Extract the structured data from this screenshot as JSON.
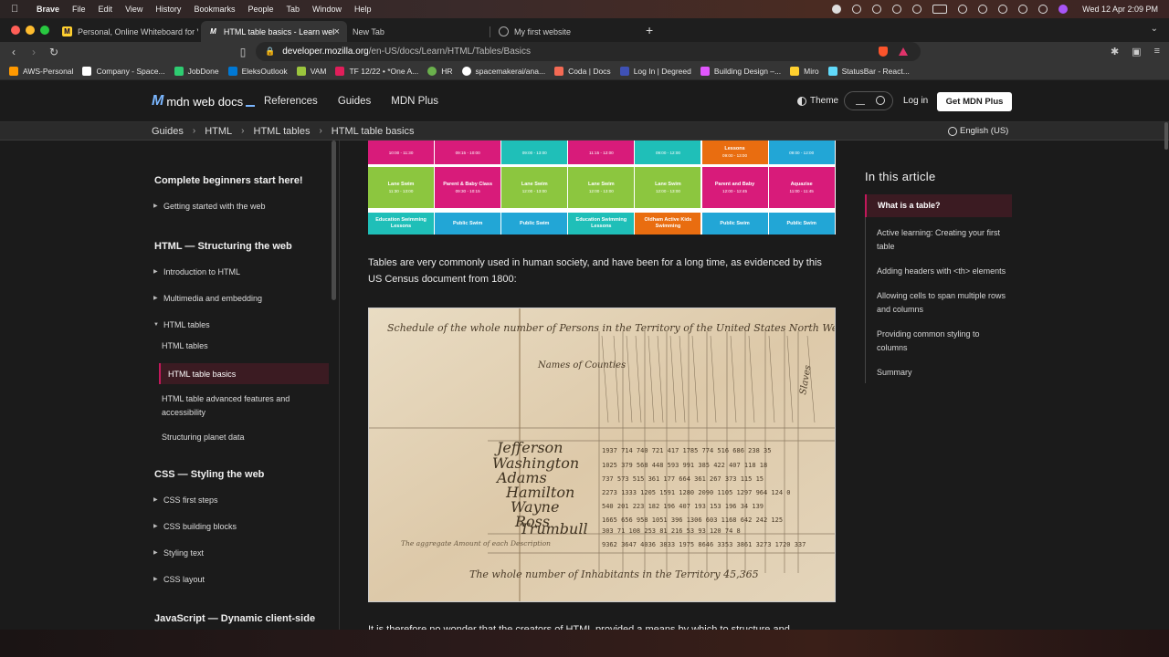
{
  "menubar": {
    "app": "Brave",
    "items": [
      "File",
      "Edit",
      "View",
      "History",
      "Bookmarks",
      "People",
      "Tab",
      "Window",
      "Help"
    ],
    "clock": "Wed 12 Apr  2:09 PM"
  },
  "tabs": [
    {
      "title": "Personal, Online Whiteboard for Vi",
      "icon": "miro-icon"
    },
    {
      "title": "HTML table basics - Learn web",
      "icon": "mdn-icon",
      "active": true
    },
    {
      "title": "New Tab",
      "icon": ""
    },
    {
      "title": "My first website",
      "icon": "globe-icon"
    }
  ],
  "address": {
    "domain": "developer.mozilla.org",
    "path": "/en-US/docs/Learn/HTML/Tables/Basics"
  },
  "bookmarks": [
    {
      "label": "AWS-Personal",
      "color": "#ff9900"
    },
    {
      "label": "Company - Space...",
      "color": "#ffffff"
    },
    {
      "label": "JobDone",
      "color": "#2ecc71"
    },
    {
      "label": "EleksOutlook",
      "color": "#0078d4"
    },
    {
      "label": "VAM",
      "color": "#9bc53d"
    },
    {
      "label": "TF 12/22 • *One A...",
      "color": "#e01e5a"
    },
    {
      "label": "HR",
      "color": "#6ab04c"
    },
    {
      "label": "spacemakerai/ana...",
      "color": "#ffffff"
    },
    {
      "label": "Coda | Docs",
      "color": "#f46a54"
    },
    {
      "label": "Log In | Degreed",
      "color": "#3f51b5"
    },
    {
      "label": "Building Design –...",
      "color": "#e056fd"
    },
    {
      "label": "Miro",
      "color": "#ffd02f"
    },
    {
      "label": "StatusBar - React...",
      "color": "#61dafb"
    }
  ],
  "header": {
    "logo": "mdn web docs",
    "nav": [
      "References",
      "Guides",
      "MDN Plus"
    ],
    "theme": "Theme",
    "login": "Log in",
    "cta": "Get MDN Plus"
  },
  "breadcrumb": [
    "Guides",
    "HTML",
    "HTML tables",
    "HTML table basics"
  ],
  "language": "English (US)",
  "sidebar": {
    "sections": [
      {
        "title": "Complete beginners start here!",
        "items": [
          "Getting started with the web"
        ]
      },
      {
        "title": "HTML — Structuring the web",
        "items": [
          "Introduction to HTML",
          "Multimedia and embedding",
          "HTML tables"
        ],
        "subitems": [
          "HTML tables",
          "HTML table basics",
          "HTML table advanced features and accessibility",
          "Structuring planet data"
        ]
      },
      {
        "title": "CSS — Styling the web",
        "items": [
          "CSS first steps",
          "CSS building blocks",
          "Styling text",
          "CSS layout"
        ]
      },
      {
        "title": "JavaScript — Dynamic client-side"
      }
    ]
  },
  "timetable": {
    "row1": [
      {
        "label": "",
        "time": "10:00 - 11:30",
        "color": "#d81b7a"
      },
      {
        "label": "",
        "time": "09:15 - 10:00",
        "color": "#d81b7a"
      },
      {
        "label": "",
        "time": "09:00 - 13:00",
        "color": "#1fbfb8"
      },
      {
        "label": "",
        "time": "11:15 - 12:00",
        "color": "#d81b7a"
      },
      {
        "label": "",
        "time": "09:00 - 12:00",
        "color": "#1fbfb8"
      },
      {
        "label": "Lessons",
        "time": "09:00 - 13:00",
        "color": "#e96d10"
      },
      {
        "label": "",
        "time": "09:00 - 12:00",
        "color": "#22a6d6"
      }
    ],
    "row2": [
      {
        "label": "Lane Swim",
        "time": "11:30 - 13:00",
        "color": "#8cc63f"
      },
      {
        "label": "Parent & Baby Class",
        "time": "09:30 - 10:15",
        "color": "#d81b7a"
      },
      {
        "label": "Lane Swim",
        "time": "12:00 - 13:00",
        "color": "#8cc63f"
      },
      {
        "label": "Lane Swim",
        "time": "12:00 - 13:00",
        "color": "#8cc63f"
      },
      {
        "label": "Lane Swim",
        "time": "12:00 - 13:00",
        "color": "#8cc63f"
      },
      {
        "label": "Parent and Baby",
        "time": "12:00 - 12:45",
        "color": "#d81b7a"
      },
      {
        "label": "Aquazise",
        "time": "11:00 - 11:45",
        "color": "#d81b7a"
      }
    ],
    "row3": [
      {
        "label": "Education Swimming Lessons",
        "color": "#1fbfb8"
      },
      {
        "label": "Public Swim",
        "color": "#22a6d6"
      },
      {
        "label": "Public Swim",
        "color": "#22a6d6"
      },
      {
        "label": "Education Swimming Lessons",
        "color": "#1fbfb8"
      },
      {
        "label": "Oldham Active Kids Swimming",
        "color": "#e96d10"
      },
      {
        "label": "Public Swim",
        "color": "#22a6d6"
      },
      {
        "label": "Public Swim",
        "color": "#22a6d6"
      }
    ]
  },
  "content": {
    "paragraph": "Tables are very commonly used in human society, and have been for a long time, as evidenced by this US Census document from 1800:",
    "next_paragraph": "It is therefore no wonder that the creators of HTML provided a means by which to structure and"
  },
  "census": {
    "heading": "Schedule of the whole number of Persons in the Territory of the United States North West of the Ohio",
    "names_label": "Names of Counties",
    "counties": [
      "Jefferson",
      "Washington",
      "Adams",
      "Hamilton",
      "Wayne",
      "Ross",
      "Trumbull"
    ],
    "aggregate": "The aggregate Amount of each Description",
    "total": "The whole number of Inhabitants in the Territory 45,365"
  },
  "toc": {
    "title": "In this article",
    "items": [
      "What is a table?",
      "Active learning: Creating your first table",
      "Adding headers with <th> elements",
      "Allowing cells to span multiple rows and columns",
      "Providing common styling to columns",
      "Summary"
    ]
  }
}
